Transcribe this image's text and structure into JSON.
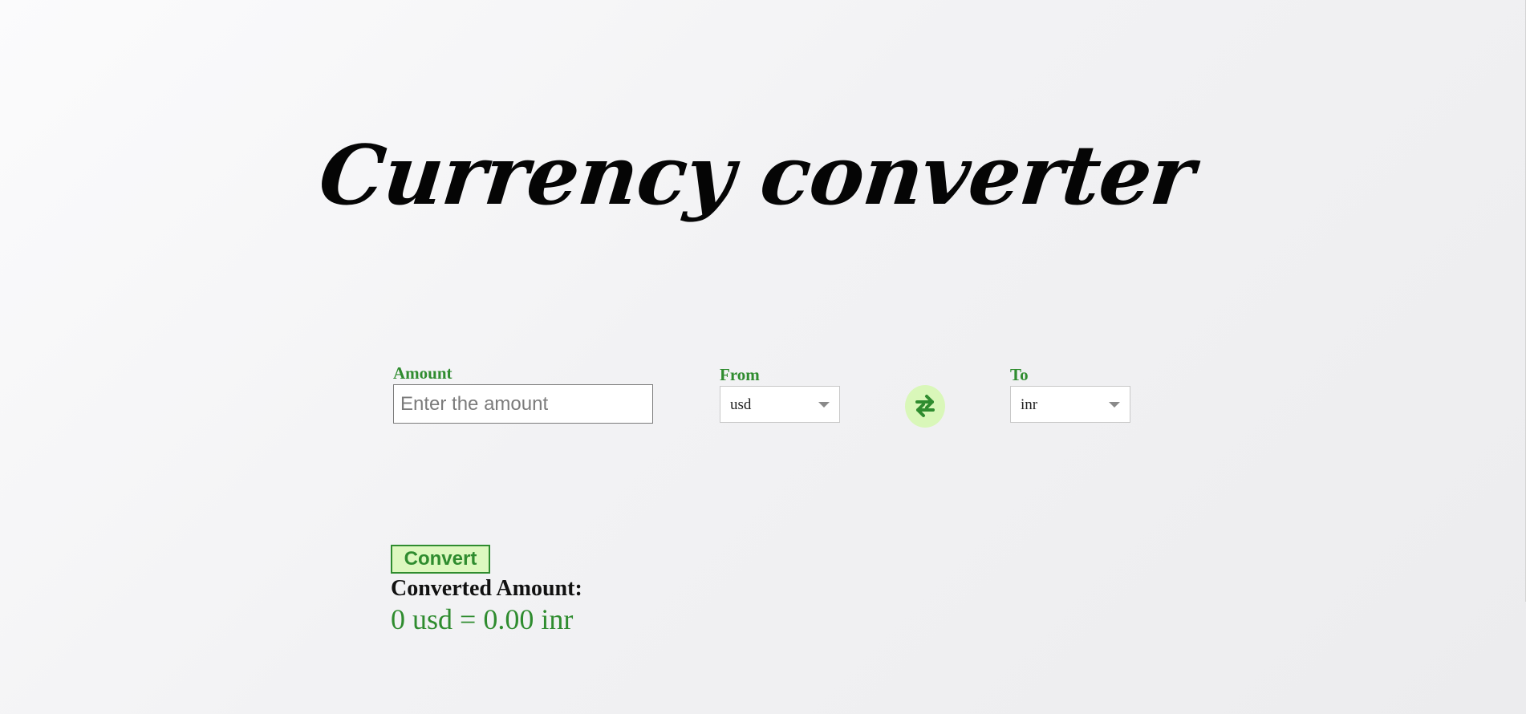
{
  "header": {
    "title": "Currency converter"
  },
  "form": {
    "amount_label": "Amount",
    "amount_placeholder": "Enter the amount",
    "amount_value": "",
    "from_label": "From",
    "from_selected": "usd",
    "to_label": "To",
    "to_selected": "inr",
    "swap_icon": "swap-arrows-icon",
    "convert_label": "Convert"
  },
  "result": {
    "heading": "Converted Amount:",
    "value": "0 usd = 0.00 inr"
  },
  "colors": {
    "accent_green": "#2f8c2f",
    "button_bg": "#ddf8bf",
    "swap_bg": "#d9f7b9",
    "title": "#050505"
  }
}
